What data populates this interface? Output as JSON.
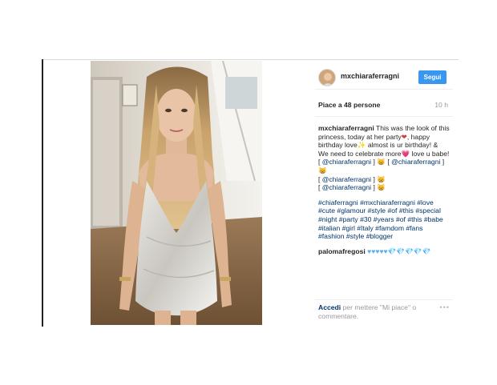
{
  "post": {
    "username": "mxchiaraferragni",
    "follow_label": "Segui",
    "likes": "Piace a 48 persone",
    "time": "10 h",
    "caption_user": "mxchiaraferragni",
    "caption_text": "This was the look of this princess, today at her party",
    "caption_cont": ", happy birthday love",
    "caption_cont2": " almost is ur birthday! & We need to celebrate more",
    "caption_end": " love u babe!",
    "mention1": "@chiaraferragni",
    "mention2": "@chiaraferragni",
    "mention3": "@chiaraferragni",
    "mention4": "@chiaraferragni",
    "hashtags": "#chiaferragni #mxchiaraferragni #love #cute #glamour #style #of #this #special #night #party #30 #years #of #this #babe #italian #girl #Italy #famdom #fans #fashion #style #blogger",
    "comment_user": "palomafregosi",
    "comment_text": "♥♥♥♥♥💎💎💎💎💎",
    "login_label": "Accedi",
    "login_text": " per mettere \"Mi piace\" o commentare.",
    "more_icon": "•••"
  },
  "colors": {
    "accent": "#3897f0",
    "link": "#003569"
  }
}
